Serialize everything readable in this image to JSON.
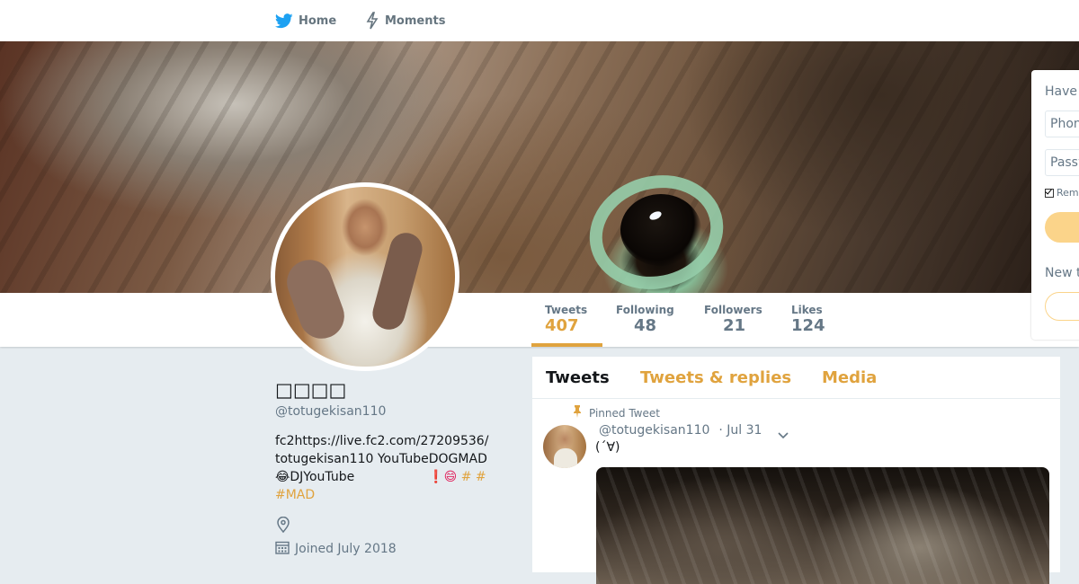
{
  "nav": {
    "home_label": "Home",
    "moments_label": "Moments"
  },
  "profile": {
    "name": "□□□□",
    "handle": "@totugekisan110",
    "bio_line1": "fc2https://live.fc2.com/27209536/",
    "bio_line2": "totugekisan110 YouTubeDOGMAD",
    "bio_line3_text": "😂DJYouTube",
    "bio_line3_mark": "❗😄",
    "bio_line3_tags": "# #",
    "bio_line4_tag": "#MAD",
    "joined": "Joined July 2018"
  },
  "stats": [
    {
      "label": "Tweets",
      "value": "407"
    },
    {
      "label": "Following",
      "value": "48"
    },
    {
      "label": "Followers",
      "value": "21"
    },
    {
      "label": "Likes",
      "value": "124"
    }
  ],
  "tabs": {
    "tweets": "Tweets",
    "replies": "Tweets & replies",
    "media": "Media"
  },
  "tweet": {
    "pinned_label": "Pinned Tweet",
    "handle": "@totugekisan110",
    "date": "· Jul 31",
    "text": "(´∀)"
  },
  "login": {
    "title": "Have",
    "phone_placeholder": "Phon",
    "password_placeholder": "Passw",
    "remember": "Rem",
    "new_text": "New t"
  },
  "colors": {
    "accent": "#e0a33e",
    "text_secondary": "#657786",
    "background": "#e6ecf0"
  }
}
